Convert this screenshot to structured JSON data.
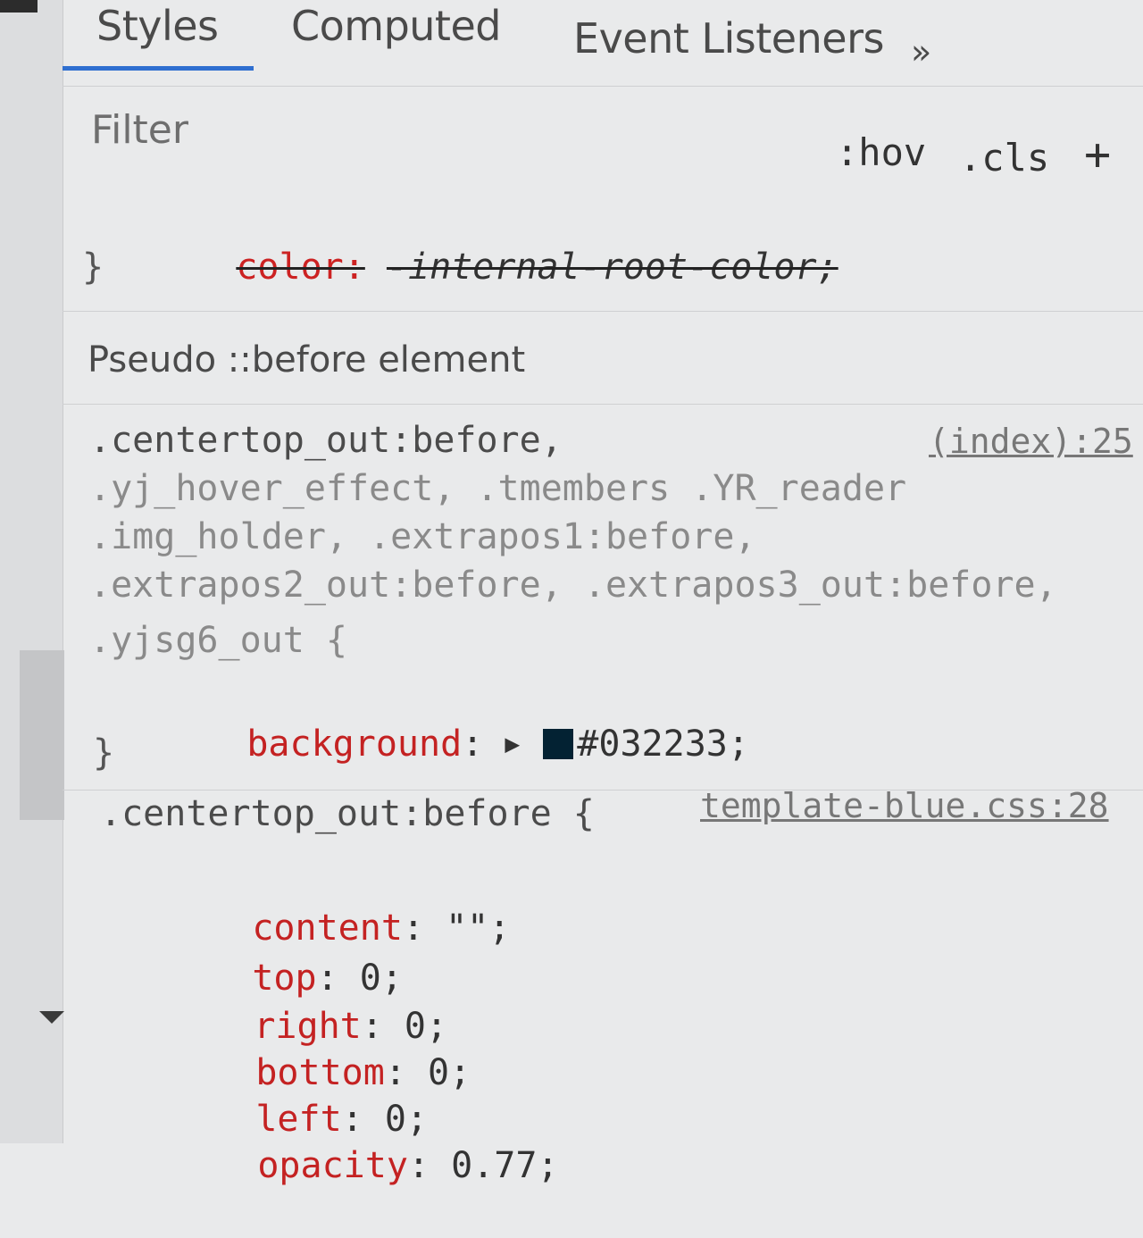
{
  "tabs": {
    "styles": "Styles",
    "computed": "Computed",
    "event_listeners": "Event Listeners",
    "more": "»"
  },
  "filter": {
    "placeholder": "Filter",
    "hov": ":hov",
    "cls": ".cls",
    "add": "+"
  },
  "prev_rule": {
    "struck_prop": "color:",
    "struck_value": "-internal-root-color;",
    "close": "}"
  },
  "pseudo_section": {
    "header": "Pseudo ::before element",
    "rule1": {
      "source": "(index):25",
      "selector_lines": [
        ".centertop_out:before,",
        ".yj_hover_effect, .tmembers .YR_reader",
        ".img_holder, .extrapos1:before,",
        ".extrapos2_out:before, .extrapos3_out:before,",
        ".yjsg6_out {"
      ],
      "declaration": {
        "prop": "background",
        "value": "#032233;"
      },
      "swatch_color": "#032233",
      "close": "}"
    },
    "rule2": {
      "selector": ".centertop_out:before {",
      "source": "template-blue.css:28",
      "declarations": [
        {
          "prop": "content",
          "value": "\"\";"
        },
        {
          "prop": "top",
          "value": "0;"
        },
        {
          "prop": "right",
          "value": "0;"
        },
        {
          "prop": "bottom",
          "value": "0;"
        },
        {
          "prop": "left",
          "value": "0;"
        },
        {
          "prop": "opacity",
          "value": "0.77;"
        }
      ]
    }
  }
}
